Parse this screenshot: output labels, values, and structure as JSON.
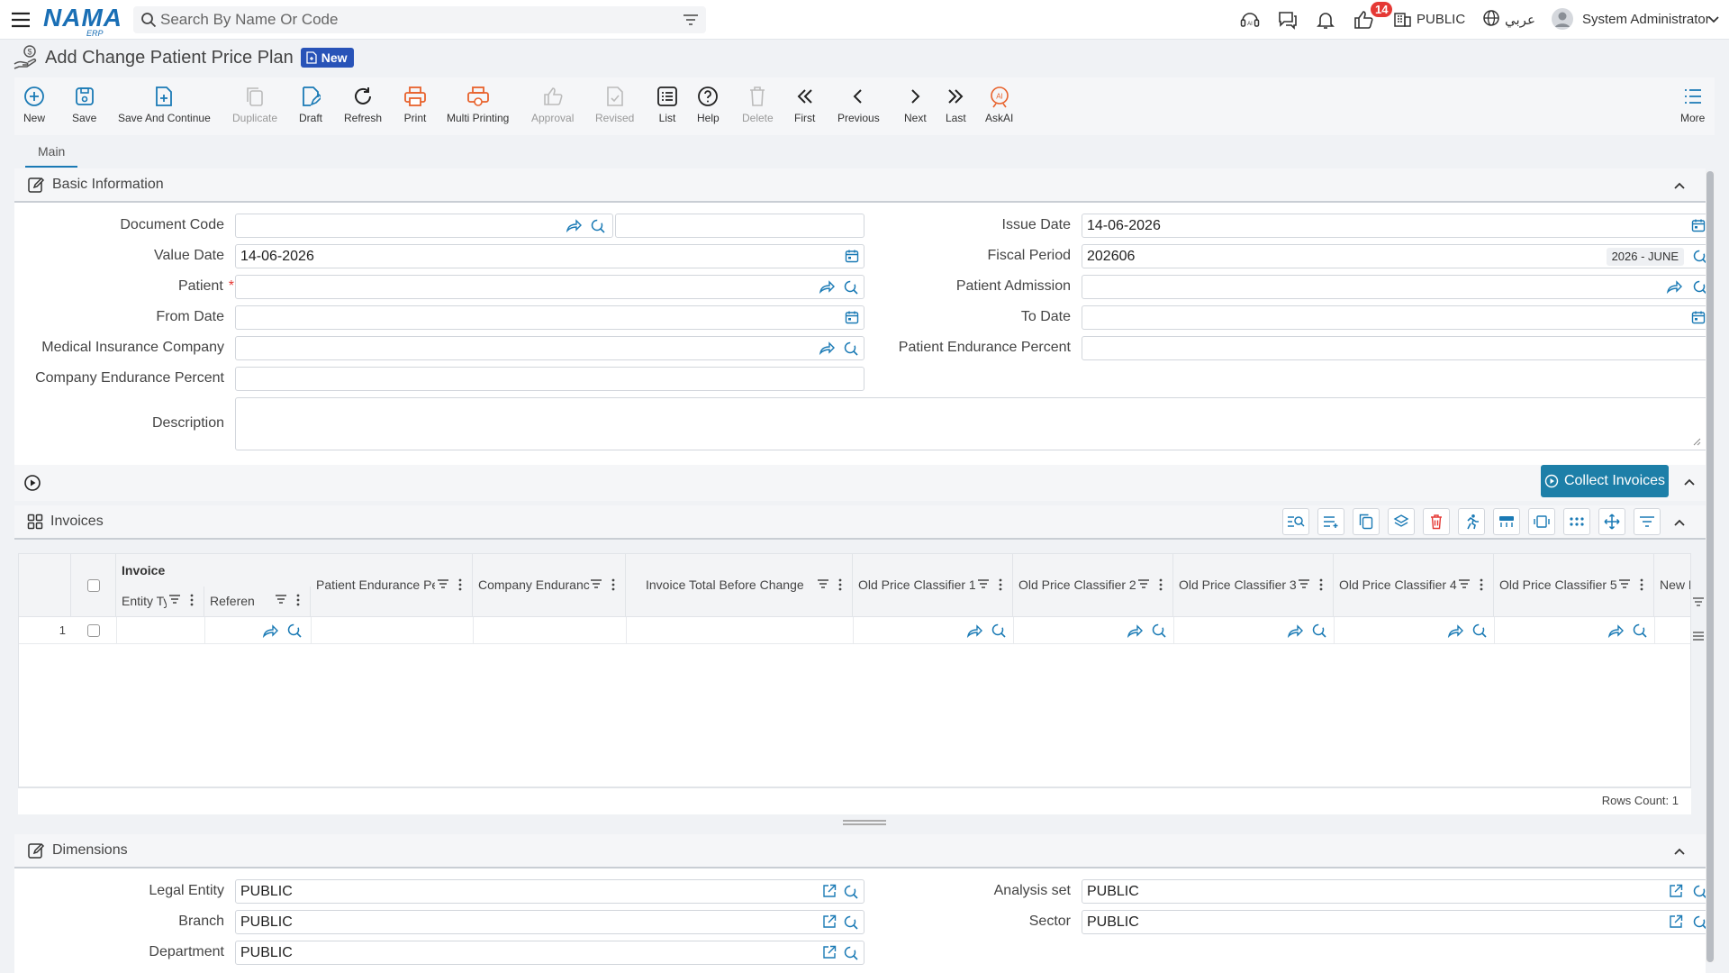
{
  "header": {
    "logo": "NAMA",
    "logo_sub": "ERP",
    "search_placeholder": "Search By Name Or Code",
    "notification_count": "14",
    "company": "PUBLIC",
    "language": "عربي",
    "user": "System Administrator"
  },
  "page": {
    "title": "Add Change Patient Price Plan",
    "status": "New"
  },
  "toolbar": {
    "new": "New",
    "save": "Save",
    "save_continue": "Save And Continue",
    "duplicate": "Duplicate",
    "draft": "Draft",
    "refresh": "Refresh",
    "print": "Print",
    "multi_printing": "Multi Printing",
    "approval": "Approval",
    "revised": "Revised",
    "list": "List",
    "help": "Help",
    "delete": "Delete",
    "first": "First",
    "previous": "Previous",
    "next": "Next",
    "last": "Last",
    "askai": "AskAI",
    "more": "More"
  },
  "tabs": {
    "main": "Main"
  },
  "basic": {
    "title": "Basic Information",
    "document_code_label": "Document Code",
    "document_code": "",
    "issue_date_label": "Issue Date",
    "issue_date": "14-06-2026",
    "value_date_label": "Value Date",
    "value_date": "14-06-2026",
    "fiscal_period_label": "Fiscal Period",
    "fiscal_period": "202606",
    "fiscal_period_tag": "2026 - JUNE",
    "patient_label": "Patient",
    "patient_required": "*",
    "patient_admission_label": "Patient Admission",
    "from_date_label": "From Date",
    "to_date_label": "To Date",
    "insurance_label": "Medical Insurance Company",
    "patient_endurance_label": "Patient Endurance Percent",
    "company_endurance_label": "Company Endurance Percent",
    "description_label": "Description"
  },
  "actions": {
    "collect_invoices": "Collect Invoices"
  },
  "invoices": {
    "title": "Invoices",
    "group_header": "Invoice",
    "columns": {
      "entity_type": "Entity Ty",
      "reference": "Referen",
      "patient_endurance": "Patient Endurance Pe",
      "company_endurance": "Company Enduranc",
      "total_before": "Invoice Total Before Change",
      "old_pc1": "Old Price Classifier 1",
      "old_pc2": "Old Price Classifier 2",
      "old_pc3": "Old Price Classifier 3",
      "old_pc4": "Old Price Classifier 4",
      "old_pc5": "Old Price Classifier 5",
      "new_pc": "New Pric"
    },
    "row_number": "1",
    "rows_count": "Rows Count: 1"
  },
  "dimensions": {
    "title": "Dimensions",
    "legal_entity_label": "Legal Entity",
    "legal_entity": "PUBLIC",
    "analysis_set_label": "Analysis set",
    "analysis_set": "PUBLIC",
    "branch_label": "Branch",
    "branch": "PUBLIC",
    "sector_label": "Sector",
    "sector": "PUBLIC",
    "department_label": "Department",
    "department": "PUBLIC"
  },
  "colors": {
    "brand": "#1a6fb5",
    "accent": "#1d7fa8",
    "badge": "#2853b8",
    "danger": "#e53935",
    "print": "#e8622c"
  }
}
